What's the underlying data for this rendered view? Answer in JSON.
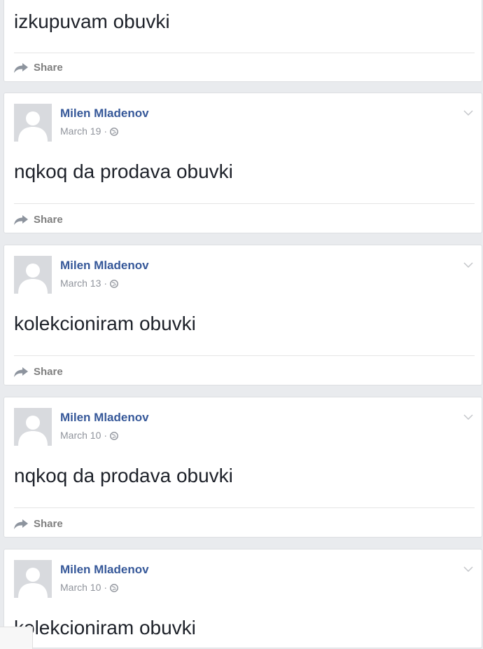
{
  "top_post": {
    "message": "izkupuvam obuvki",
    "share_label": "Share"
  },
  "posts": [
    {
      "author": "Milen Mladenov",
      "date": "March 19",
      "message": "nqkoq da prodava obuvki",
      "share_label": "Share"
    },
    {
      "author": "Milen Mladenov",
      "date": "March 13",
      "message": "kolekcioniram obuvki",
      "share_label": "Share"
    },
    {
      "author": "Milen Mladenov",
      "date": "March 10",
      "message": "nqkoq da prodava obuvki",
      "share_label": "Share"
    },
    {
      "author": "Milen Mladenov",
      "date": "March 10",
      "message": "kolekcioniram obuvki"
    }
  ],
  "separator": "·",
  "icons": {
    "share": "share-arrow-icon",
    "privacy": "globe-icon",
    "menu": "chevron-down-icon",
    "avatar": "default-avatar-silhouette"
  },
  "colors": {
    "author": "#365899",
    "meta": "#90949c",
    "share": "#7f7f7f",
    "background": "#e9ebee"
  }
}
